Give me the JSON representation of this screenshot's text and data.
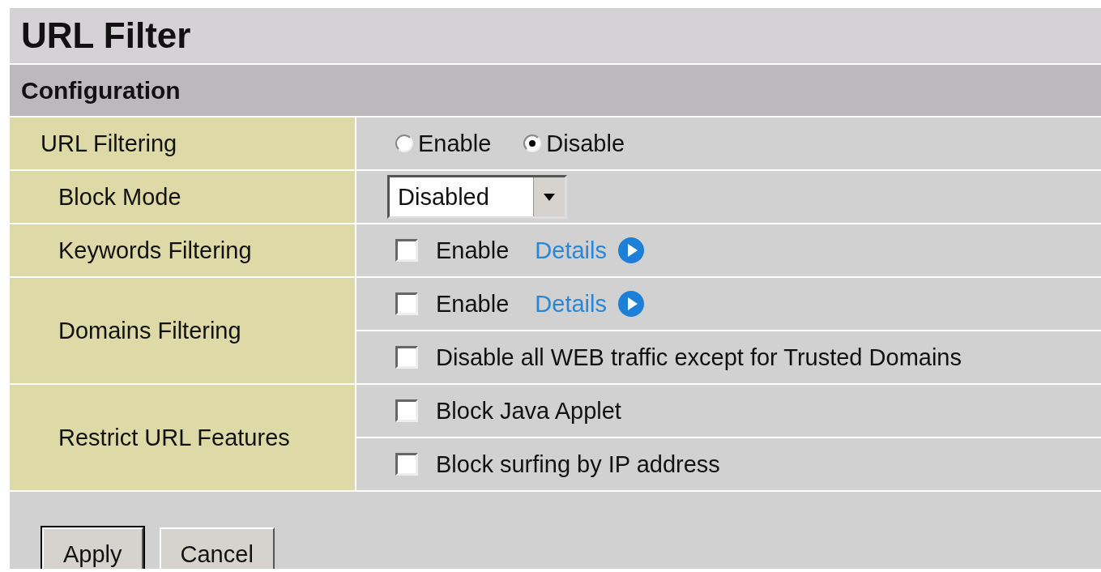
{
  "title": "URL Filter",
  "section": "Configuration",
  "rows": [
    {
      "label": "URL Filtering",
      "indent": false,
      "lines": [
        {
          "kind": "radios",
          "radios": [
            {
              "label": "Enable",
              "selected": false
            },
            {
              "label": "Disable",
              "selected": true
            }
          ]
        }
      ]
    },
    {
      "label": "Block Mode",
      "indent": true,
      "lines": [
        {
          "kind": "select",
          "value": "Disabled"
        }
      ]
    },
    {
      "label": "Keywords Filtering",
      "indent": true,
      "lines": [
        {
          "kind": "checkbox",
          "label": "Enable",
          "checked": false,
          "link": "Details"
        }
      ]
    },
    {
      "label": "Domains Filtering",
      "indent": true,
      "lines": [
        {
          "kind": "checkbox",
          "label": "Enable",
          "checked": false,
          "link": "Details"
        },
        {
          "kind": "checkbox",
          "label": "Disable all WEB traffic except for Trusted Domains",
          "checked": false
        }
      ]
    },
    {
      "label": "Restrict URL Features",
      "indent": true,
      "lines": [
        {
          "kind": "checkbox",
          "label": "Block Java Applet",
          "checked": false
        },
        {
          "kind": "checkbox",
          "label": "Block surfing by IP address",
          "checked": false
        }
      ]
    }
  ],
  "buttons": [
    {
      "label": "Apply",
      "default": true
    },
    {
      "label": "Cancel",
      "default": false
    }
  ]
}
